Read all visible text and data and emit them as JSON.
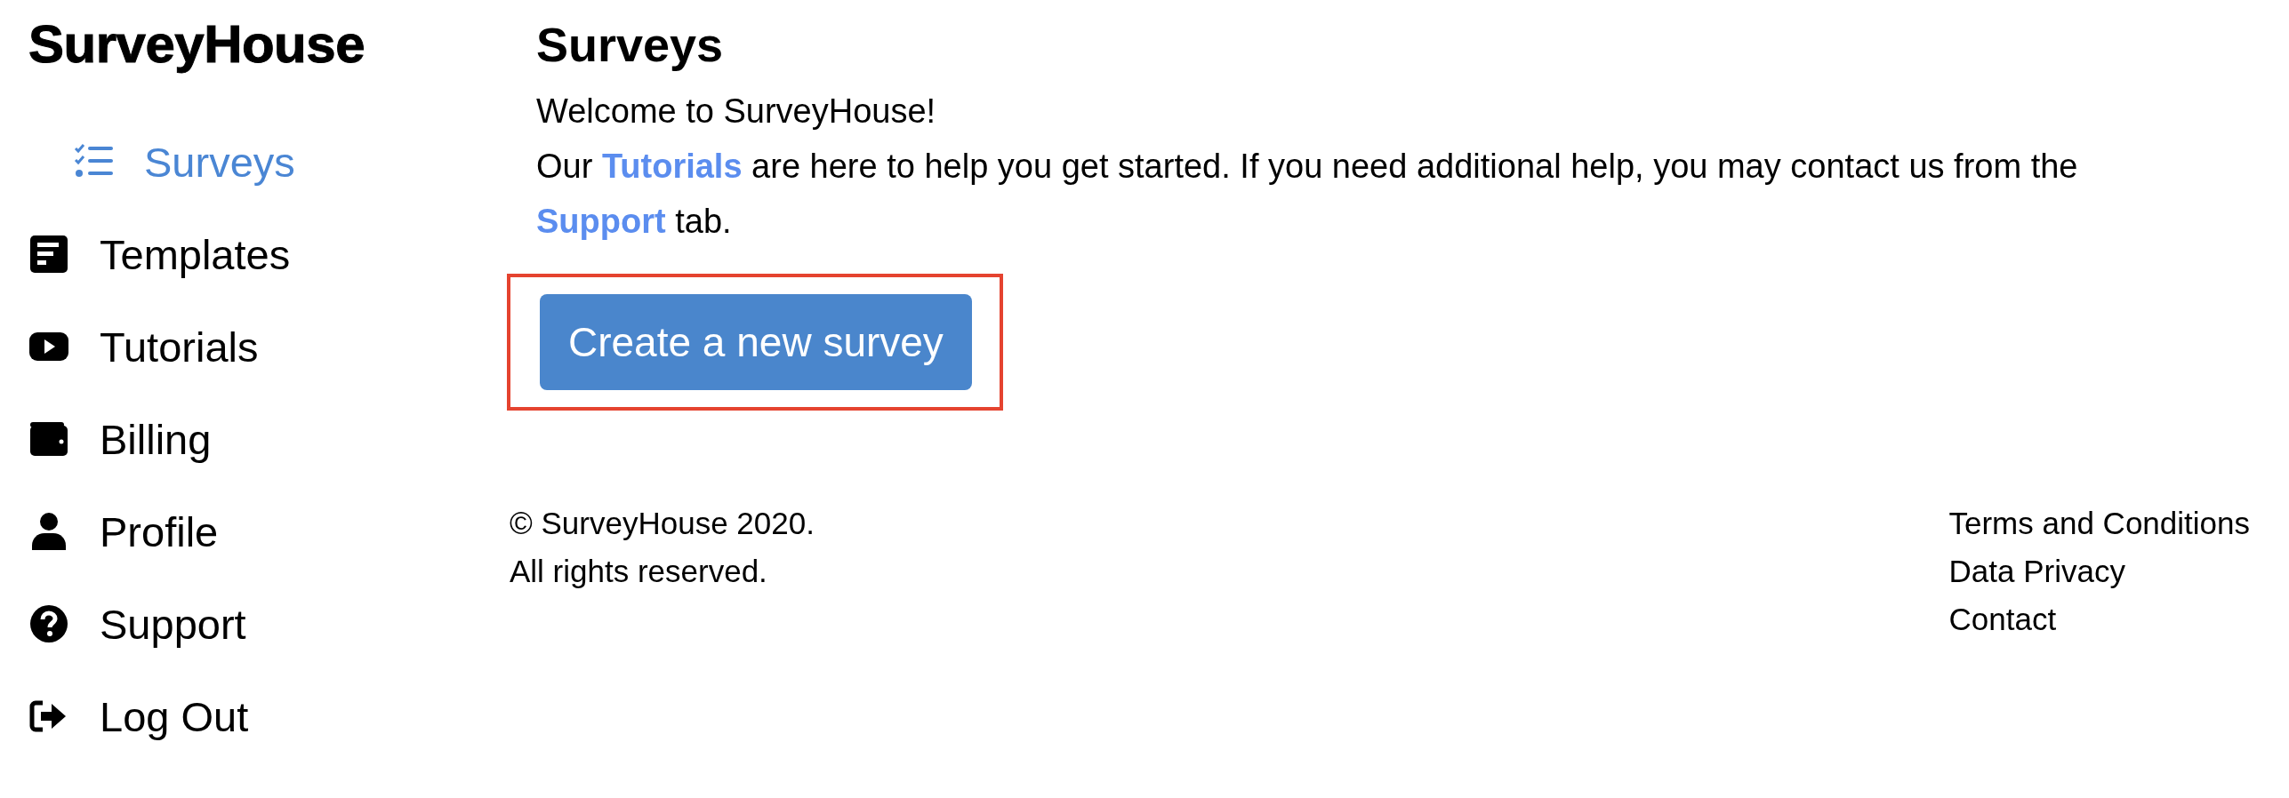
{
  "logo": "SurveyHouse",
  "sidebar": {
    "items": [
      {
        "label": "Surveys",
        "kind": "checklist",
        "selected": true
      },
      {
        "label": "Templates",
        "kind": "document",
        "selected": false
      },
      {
        "label": "Tutorials",
        "kind": "play",
        "selected": false
      },
      {
        "label": "Billing",
        "kind": "wallet",
        "selected": false
      },
      {
        "label": "Profile",
        "kind": "user",
        "selected": false
      },
      {
        "label": "Support",
        "kind": "help",
        "selected": false
      },
      {
        "label": "Log Out",
        "kind": "logout",
        "selected": false
      }
    ]
  },
  "main": {
    "title": "Surveys",
    "welcome": "Welcome to SurveyHouse!",
    "intro": [
      {
        "kind": "text",
        "text": "Our "
      },
      {
        "kind": "link",
        "text": "Tutorials"
      },
      {
        "kind": "text",
        "text": " are here to help you get started. If you need additional help, you may contact us from the "
      },
      {
        "kind": "link",
        "text": "Support"
      },
      {
        "kind": "text",
        "text": " tab."
      }
    ],
    "button": {
      "label": "Create a new survey",
      "highlighted": true
    }
  },
  "footer": {
    "copyright": [
      "© SurveyHouse 2020.",
      "All rights reserved."
    ],
    "links": [
      "Terms and Conditions",
      "Data Privacy",
      "Contact"
    ]
  }
}
